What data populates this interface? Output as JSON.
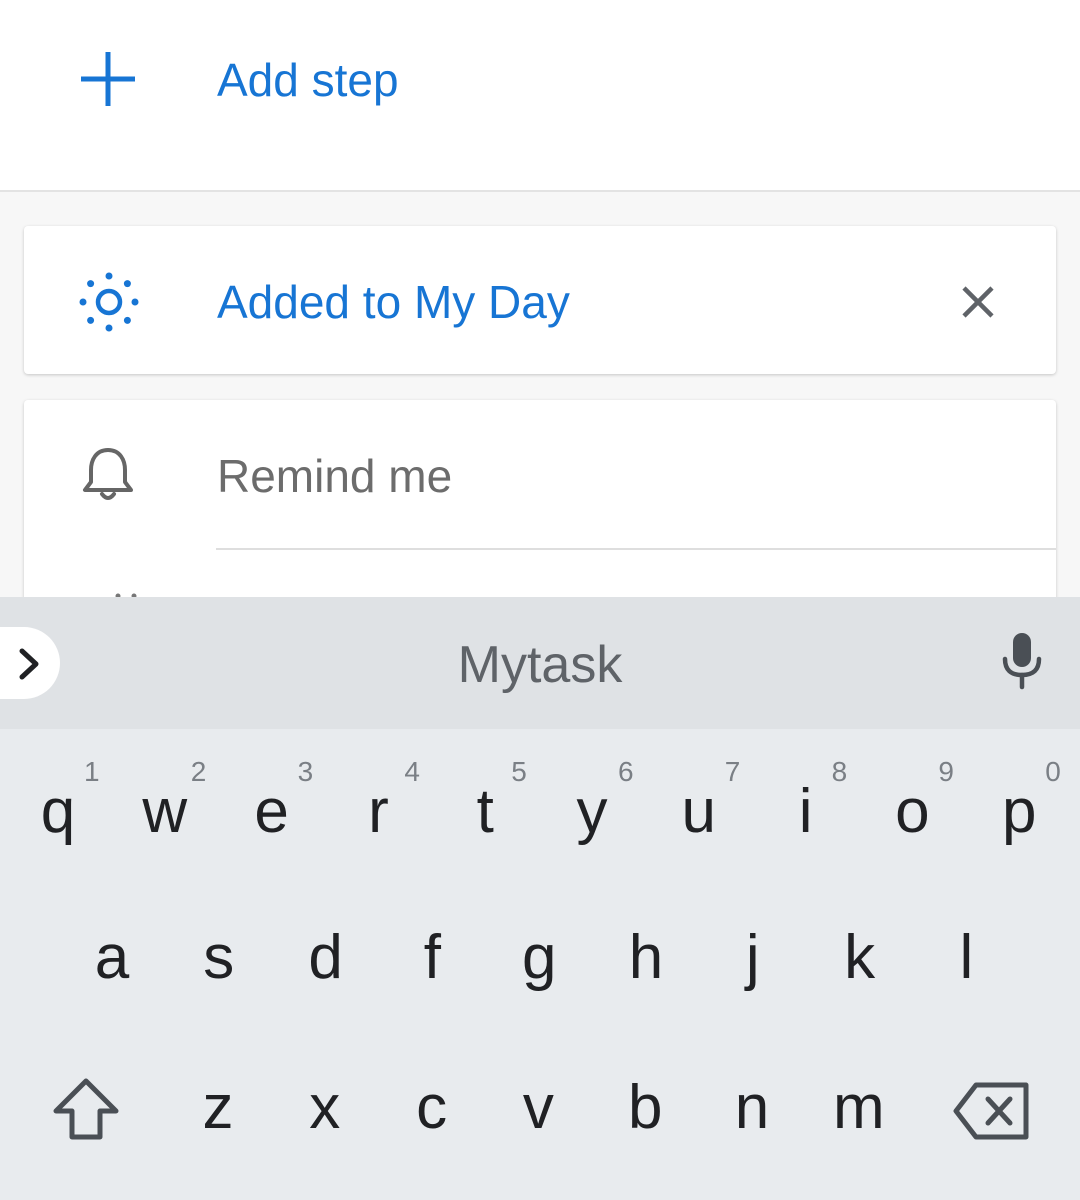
{
  "task": {
    "add_step_label": "Add step",
    "my_day_label": "Added to My Day",
    "remind_label": "Remind me"
  },
  "keyboard": {
    "suggestion": "Mytask",
    "row1": [
      {
        "key": "q",
        "hint": "1"
      },
      {
        "key": "w",
        "hint": "2"
      },
      {
        "key": "e",
        "hint": "3"
      },
      {
        "key": "r",
        "hint": "4"
      },
      {
        "key": "t",
        "hint": "5"
      },
      {
        "key": "y",
        "hint": "6"
      },
      {
        "key": "u",
        "hint": "7"
      },
      {
        "key": "i",
        "hint": "8"
      },
      {
        "key": "o",
        "hint": "9"
      },
      {
        "key": "p",
        "hint": "0"
      }
    ],
    "row2": [
      "a",
      "s",
      "d",
      "f",
      "g",
      "h",
      "j",
      "k",
      "l"
    ],
    "row3": [
      "z",
      "x",
      "c",
      "v",
      "b",
      "n",
      "m"
    ]
  },
  "colors": {
    "accent": "#1775d4",
    "muted_text": "#6c6c6c",
    "keyboard_bg": "#e8ebee",
    "suggestion_bg": "#dfe2e5"
  },
  "icons": {
    "add": "plus-icon",
    "my_day": "sun-icon",
    "remove": "close-icon",
    "reminder": "bell-icon",
    "expand": "chevron-right-icon",
    "voice": "mic-icon",
    "shift": "shift-icon",
    "delete": "backspace-icon"
  }
}
